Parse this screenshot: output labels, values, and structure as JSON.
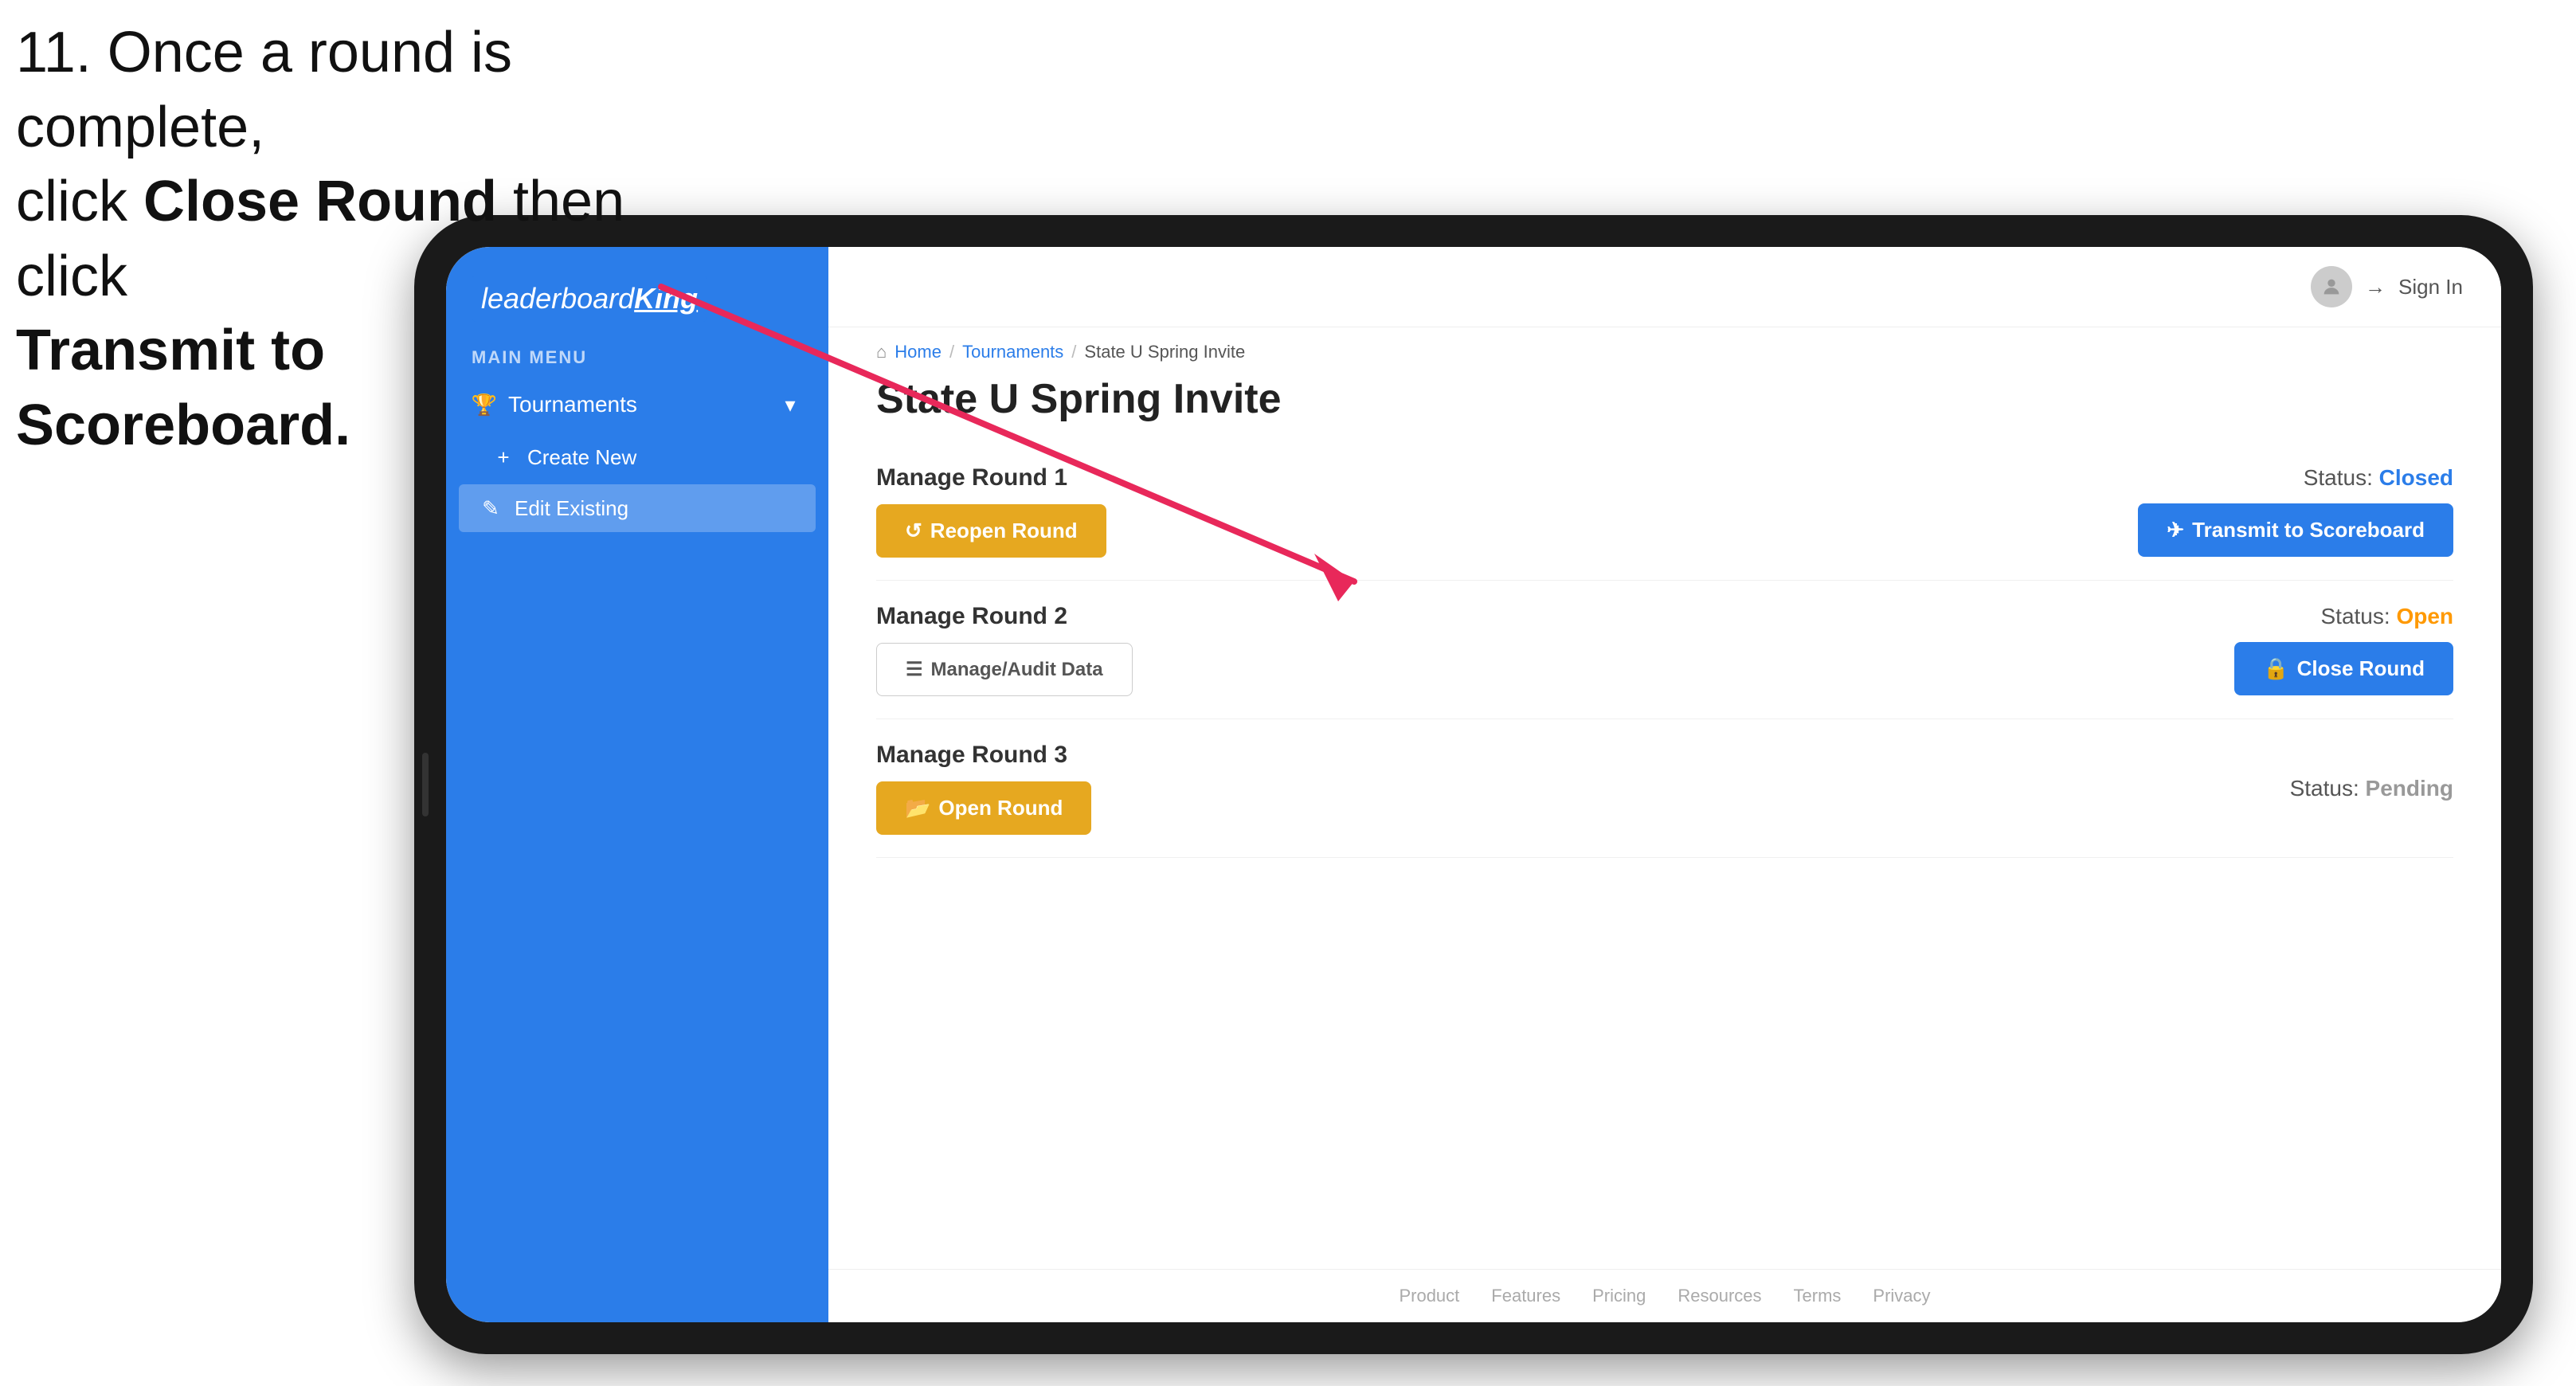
{
  "instruction": {
    "line1": "11. Once a round is complete,",
    "line2_pre": "click ",
    "line2_bold": "Close Round",
    "line2_post": " then click",
    "line3_bold": "Transmit to Scoreboard."
  },
  "app": {
    "logo": {
      "text_leaderboard": "leaderboard",
      "text_king": "King"
    },
    "sidebar": {
      "section_label": "MAIN MENU",
      "tournaments_label": "Tournaments",
      "create_new_label": "Create New",
      "edit_existing_label": "Edit Existing",
      "trophy_icon": "🏆",
      "plus_icon": "+",
      "edit_icon": "✎",
      "chevron_icon": "▾"
    },
    "topbar": {
      "sign_in_label": "Sign In",
      "sign_in_arrow": "→"
    },
    "breadcrumb": {
      "home": "Home",
      "tournaments": "Tournaments",
      "current": "State U Spring Invite",
      "home_icon": "⌂"
    },
    "page_title": "State U Spring Invite",
    "rounds": [
      {
        "id": "round1",
        "title": "Manage Round 1",
        "status_label": "Status:",
        "status_value": "Closed",
        "status_type": "closed",
        "primary_button_label": "Reopen Round",
        "primary_button_type": "gold",
        "primary_button_icon": "↺",
        "secondary_button_label": "Transmit to Scoreboard",
        "secondary_button_type": "blue",
        "secondary_button_icon": "✈"
      },
      {
        "id": "round2",
        "title": "Manage Round 2",
        "status_label": "Status:",
        "status_value": "Open",
        "status_type": "open",
        "primary_button_label": "Manage/Audit Data",
        "primary_button_type": "outline",
        "primary_button_icon": "☰",
        "secondary_button_label": "Close Round",
        "secondary_button_type": "blue",
        "secondary_button_icon": "🔒"
      },
      {
        "id": "round3",
        "title": "Manage Round 3",
        "status_label": "Status:",
        "status_value": "Pending",
        "status_type": "pending",
        "primary_button_label": "Open Round",
        "primary_button_type": "gold",
        "primary_button_icon": "📂",
        "secondary_button_label": null,
        "secondary_button_type": null
      }
    ],
    "footer": {
      "links": [
        "Product",
        "Features",
        "Pricing",
        "Resources",
        "Terms",
        "Privacy"
      ]
    }
  },
  "colors": {
    "sidebar_bg": "#2b7de9",
    "btn_gold": "#e6a820",
    "btn_blue": "#2b7de9",
    "status_closed": "#2b7de9",
    "status_open": "#f90",
    "status_pending": "#999"
  }
}
